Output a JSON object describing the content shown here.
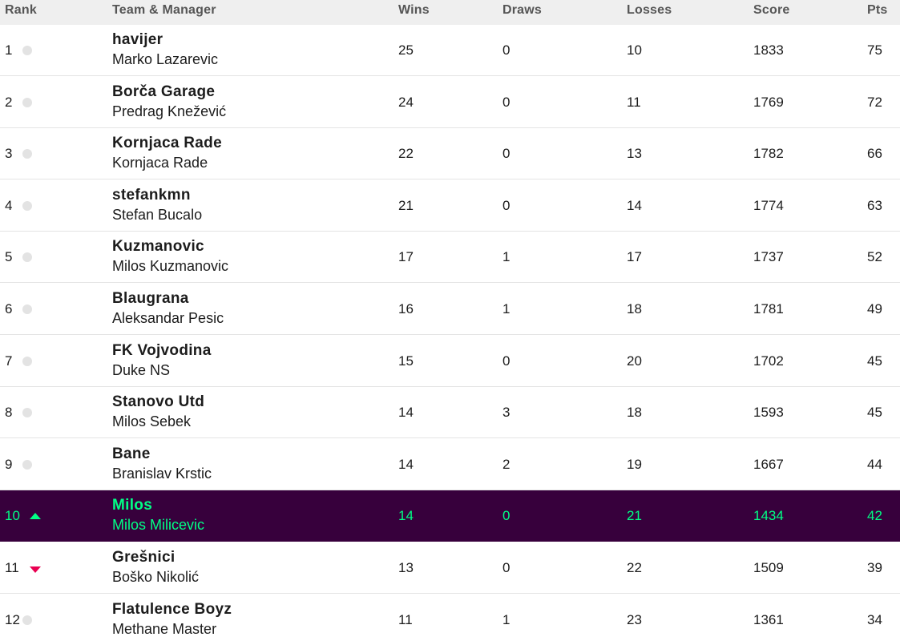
{
  "headers": {
    "rank": "Rank",
    "team_manager": "Team & Manager",
    "wins": "Wins",
    "draws": "Draws",
    "losses": "Losses",
    "score": "Score",
    "pts": "Pts"
  },
  "rows": [
    {
      "rank": "1",
      "movement": "same",
      "team": "havijer",
      "manager": "Marko Lazarevic",
      "wins": "25",
      "draws": "0",
      "losses": "10",
      "score": "1833",
      "pts": "75"
    },
    {
      "rank": "2",
      "movement": "same",
      "team": "Borča Garage",
      "manager": "Predrag Knežević",
      "wins": "24",
      "draws": "0",
      "losses": "11",
      "score": "1769",
      "pts": "72"
    },
    {
      "rank": "3",
      "movement": "same",
      "team": "Kornjaca Rade",
      "manager": "Kornjaca Rade",
      "wins": "22",
      "draws": "0",
      "losses": "13",
      "score": "1782",
      "pts": "66"
    },
    {
      "rank": "4",
      "movement": "same",
      "team": "stefankmn",
      "manager": "Stefan Bucalo",
      "wins": "21",
      "draws": "0",
      "losses": "14",
      "score": "1774",
      "pts": "63"
    },
    {
      "rank": "5",
      "movement": "same",
      "team": "Kuzmanovic",
      "manager": "Milos Kuzmanovic",
      "wins": "17",
      "draws": "1",
      "losses": "17",
      "score": "1737",
      "pts": "52"
    },
    {
      "rank": "6",
      "movement": "same",
      "team": "Blaugrana",
      "manager": "Aleksandar Pesic",
      "wins": "16",
      "draws": "1",
      "losses": "18",
      "score": "1781",
      "pts": "49"
    },
    {
      "rank": "7",
      "movement": "same",
      "team": "FK Vojvodina",
      "manager": "Duke NS",
      "wins": "15",
      "draws": "0",
      "losses": "20",
      "score": "1702",
      "pts": "45"
    },
    {
      "rank": "8",
      "movement": "same",
      "team": "Stanovo Utd",
      "manager": "Milos Sebek",
      "wins": "14",
      "draws": "3",
      "losses": "18",
      "score": "1593",
      "pts": "45"
    },
    {
      "rank": "9",
      "movement": "same",
      "team": "Bane",
      "manager": "Branislav Krstic",
      "wins": "14",
      "draws": "2",
      "losses": "19",
      "score": "1667",
      "pts": "44"
    },
    {
      "rank": "10",
      "movement": "up",
      "team": "Milos",
      "manager": "Milos Milicevic",
      "wins": "14",
      "draws": "0",
      "losses": "21",
      "score": "1434",
      "pts": "42",
      "highlighted": true
    },
    {
      "rank": "11",
      "movement": "down",
      "team": "Grešnici",
      "manager": "Boško Nikolić",
      "wins": "13",
      "draws": "0",
      "losses": "22",
      "score": "1509",
      "pts": "39"
    },
    {
      "rank": "12",
      "movement": "same",
      "team": "Flatulence Boyz",
      "manager": "Methane Master",
      "wins": "11",
      "draws": "1",
      "losses": "23",
      "score": "1361",
      "pts": "34"
    }
  ],
  "colors": {
    "highlight_bg": "#37003c",
    "highlight_text": "#00ff85",
    "up_arrow": "#00ff85",
    "down_arrow": "#e90052",
    "same_dot": "#e3e3e3",
    "header_bg": "#efefef"
  }
}
